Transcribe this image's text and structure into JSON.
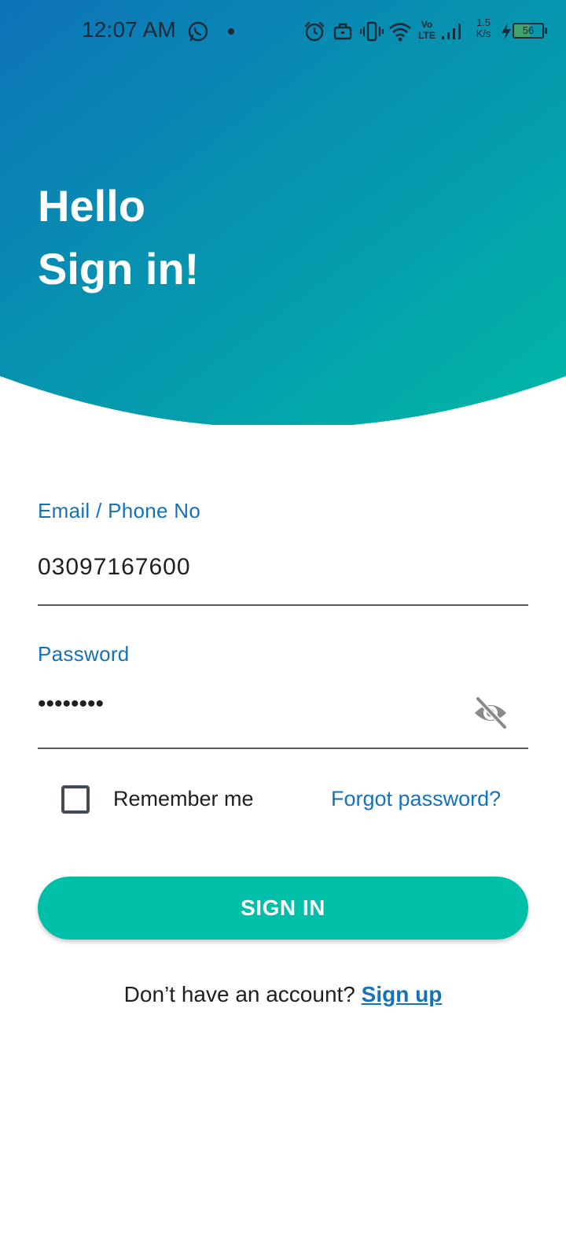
{
  "status_bar": {
    "time": "12:07 AM",
    "net_speed_value": "1.5",
    "net_speed_unit": "K/s",
    "volte_top": "Vo",
    "volte_bottom": "LTE",
    "battery_level": "56",
    "icons": [
      "whatsapp-icon",
      "notification-dot-icon",
      "alarm-icon",
      "briefcase-icon",
      "vibrate-icon",
      "wifi-icon",
      "volte-icon",
      "signal-icon",
      "charging-icon",
      "battery-icon"
    ]
  },
  "header": {
    "line1": "Hello",
    "line2": "Sign in!",
    "gradient_start": "#0d73b8",
    "gradient_end": "#00b8a6"
  },
  "form": {
    "email_label": "Email / Phone No",
    "email_value": "03097167600",
    "password_label": "Password",
    "password_value": "••••••••",
    "password_toggle_icon": "eye-off-icon",
    "remember_label": "Remember me",
    "remember_checked": false,
    "forgot_label": "Forgot password?"
  },
  "actions": {
    "sign_in_label": "SIGN IN",
    "no_account_text": "Don’t have an account?",
    "sign_up_label": "Sign up"
  },
  "colors": {
    "accent_blue": "#1572b7",
    "button_teal": "#00bfa8",
    "text_dark": "#1f1f1f"
  }
}
